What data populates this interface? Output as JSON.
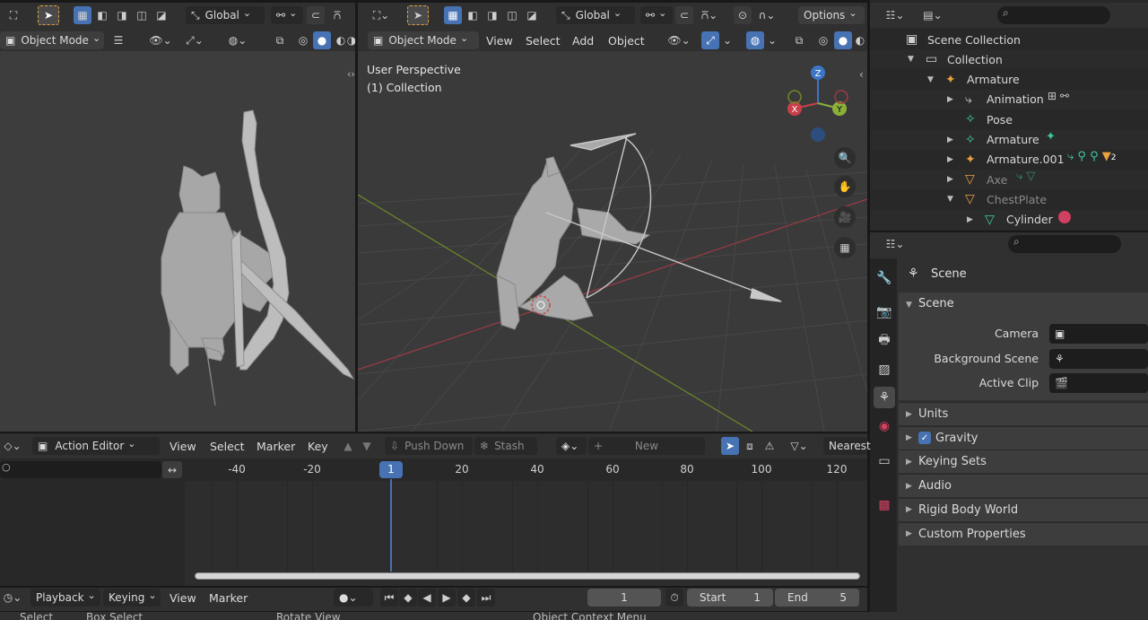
{
  "left_viewport": {
    "mode": "Object Mode",
    "orientation": "Global"
  },
  "main_viewport": {
    "mode": "Object Mode",
    "orientation": "Global",
    "options": "Options",
    "menus": [
      "View",
      "Select",
      "Add",
      "Object"
    ],
    "overlay_line1": "User Perspective",
    "overlay_line2": "(1) Collection",
    "gizmo": {
      "x": "X",
      "y": "Y",
      "z": "Z"
    }
  },
  "outliner": {
    "items": [
      {
        "label": "Scene Collection",
        "indent": 0,
        "icon": "scene-collection-icon",
        "color": "#d8d8d8"
      },
      {
        "label": "Collection",
        "indent": 1,
        "icon": "collection-icon",
        "color": "#d8d8d8"
      },
      {
        "label": "Armature",
        "indent": 2,
        "icon": "armature-icon",
        "color": "#d8d8d8"
      },
      {
        "label": "Animation",
        "indent": 3,
        "icon": "animation-icon",
        "color": "#d8d8d8"
      },
      {
        "label": "Pose",
        "indent": 3,
        "icon": "pose-icon",
        "color": "#d8d8d8"
      },
      {
        "label": "Armature",
        "indent": 3,
        "icon": "armature-data-icon",
        "color": "#d8d8d8"
      },
      {
        "label": "Armature.001",
        "indent": 3,
        "icon": "armature-icon",
        "color": "#d8d8d8"
      },
      {
        "label": "Axe",
        "indent": 3,
        "icon": "mesh-icon",
        "color": "#8a8a8a"
      },
      {
        "label": "ChestPlate",
        "indent": 3,
        "icon": "mesh-icon",
        "color": "#8a8a8a"
      },
      {
        "label": "Cylinder",
        "indent": 4,
        "icon": "mesh-data-icon",
        "color": "#d8d8d8"
      }
    ],
    "badge": "2"
  },
  "properties": {
    "title": "Scene",
    "section": "Scene",
    "fields": [
      {
        "label": "Camera"
      },
      {
        "label": "Background Scene"
      },
      {
        "label": "Active Clip"
      }
    ],
    "panels": [
      {
        "label": "Units",
        "checkbox": false
      },
      {
        "label": "Gravity",
        "checkbox": true
      },
      {
        "label": "Keying Sets",
        "checkbox": false
      },
      {
        "label": "Audio",
        "checkbox": false
      },
      {
        "label": "Rigid Body World",
        "checkbox": false
      },
      {
        "label": "Custom Properties",
        "checkbox": false
      }
    ]
  },
  "action_editor": {
    "mode": "Action Editor",
    "menus": [
      "View",
      "Select",
      "Marker",
      "Key"
    ],
    "push_down": "Push Down",
    "stash": "Stash",
    "new": "New",
    "snap": "Nearest",
    "ruler": [
      "-40",
      "-20",
      "1",
      "20",
      "40",
      "60",
      "80",
      "100",
      "120"
    ],
    "current_frame": "1"
  },
  "timeline": {
    "menus": [
      "Playback",
      "Keying",
      "View",
      "Marker"
    ],
    "frame": "1",
    "start_label": "Start",
    "start": "1",
    "end_label": "End",
    "end": "5"
  },
  "status": {
    "items": [
      "Select",
      "Box Select",
      "Rotate View",
      "Object Context Menu"
    ]
  }
}
